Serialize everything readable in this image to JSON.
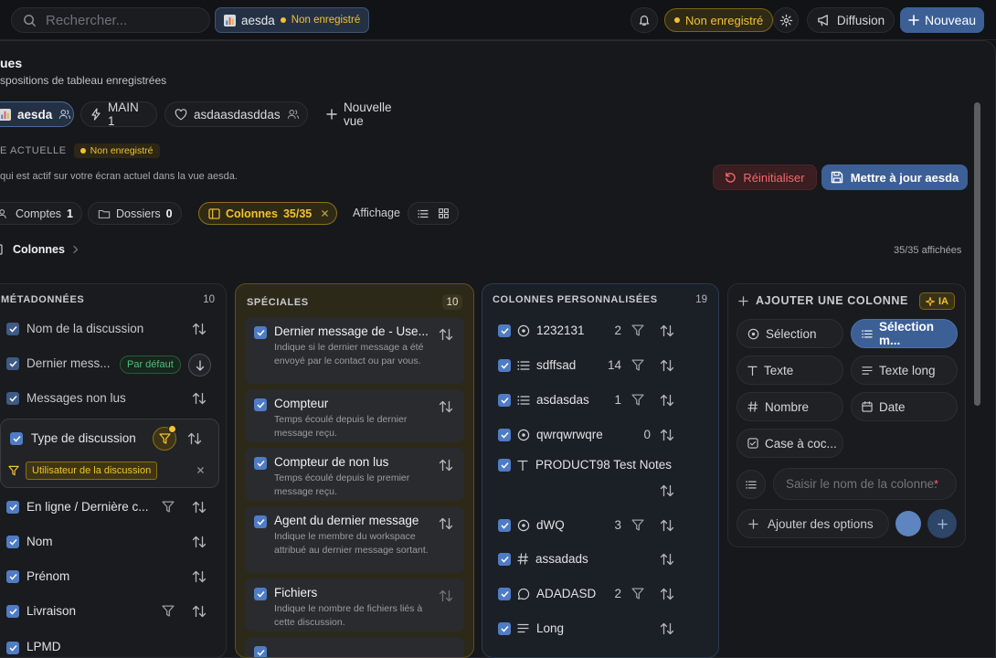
{
  "topbar": {
    "search_placeholder": "Rechercher...",
    "view_chip": {
      "label": "aesda",
      "status": "Non enregistré"
    },
    "unsaved_pill": "Non enregistré",
    "diffusion": "Diffusion",
    "new_button": "Nouveau"
  },
  "views": {
    "title": "ues",
    "subtitle": "spositions de tableau enregistrées",
    "tabs": [
      {
        "label": "aesda"
      },
      {
        "label": "MAIN 1"
      },
      {
        "label": "asdaasdasddas"
      },
      {
        "label": "Nouvelle vue"
      }
    ]
  },
  "current": {
    "label": "E ACTUELLE",
    "badge": "Non enregistré",
    "description": "qui est actif sur votre écran actuel dans la vue aesda.",
    "reset": "Réinitialiser",
    "update": "Mettre à jour aesda"
  },
  "filters": {
    "comptes": {
      "label": "Comptes",
      "count": "1"
    },
    "dossiers": {
      "label": "Dossiers",
      "count": "0"
    },
    "colonnes": {
      "label": "Colonnes",
      "count": "35/35"
    },
    "affichage": "Affichage"
  },
  "columns_section": {
    "label": "Colonnes",
    "shown": "35/35 affichées"
  },
  "metadata": {
    "header": "MÉTADONNÉES",
    "count": "10",
    "rows": [
      {
        "label": "Nom de la discussion"
      },
      {
        "label": "Dernier mess...",
        "badge": "Par défaut"
      },
      {
        "label": "Messages non lus"
      },
      {
        "label": "Type de discussion",
        "filter_tag": "Utilisateur de la discussion"
      },
      {
        "label": "En ligne / Dernière c..."
      },
      {
        "label": "Nom"
      },
      {
        "label": "Prénom"
      },
      {
        "label": "Livraison"
      },
      {
        "label": "LPMD"
      }
    ]
  },
  "speciales": {
    "header": "SPÉCIALES",
    "count": "10",
    "cards": [
      {
        "name": "Dernier message de - Use...",
        "desc": "Indique si le dernier message a été envoyé par le contact ou par vous."
      },
      {
        "name": "Compteur",
        "desc": "Temps écoulé depuis le dernier message reçu."
      },
      {
        "name": "Compteur de non lus",
        "desc": "Temps écoulé depuis le premier message reçu."
      },
      {
        "name": "Agent du dernier message",
        "desc": "Indique le membre du workspace attribué au dernier message sortant."
      },
      {
        "name": "Fichiers",
        "desc": "Indique le nombre de fichiers liés à cette discussion."
      }
    ]
  },
  "custom": {
    "header": "COLONNES PERSONNALISÉES",
    "count": "19",
    "rows": [
      {
        "label": "1232131",
        "num": "2"
      },
      {
        "label": "sdffsad",
        "num": "14"
      },
      {
        "label": "asdasdas",
        "num": "1"
      },
      {
        "label": "qwrqwrwqre",
        "num": "0"
      },
      {
        "label": "PRODUCT98 Test Notes",
        "num": ""
      },
      {
        "label": "dWQ",
        "num": "3"
      },
      {
        "label": "assadads",
        "num": ""
      },
      {
        "label": "ADADASD",
        "num": "2"
      },
      {
        "label": "Long",
        "num": ""
      }
    ]
  },
  "add_column": {
    "header": "AJOUTER UNE COLONNE",
    "ai_badge": "IA",
    "types": [
      "Sélection",
      "Sélection m...",
      "Texte",
      "Texte long",
      "Nombre",
      "Date",
      "Case à coc..."
    ],
    "name_placeholder": "Saisir le nom de la colonne.",
    "required_mark": "*",
    "add_options": "Ajouter des options"
  },
  "colors": {
    "accent": "#3c5f96",
    "warning": "#f2c230",
    "danger": "#ef6b6b",
    "checkbox": "#4f7cc4"
  }
}
